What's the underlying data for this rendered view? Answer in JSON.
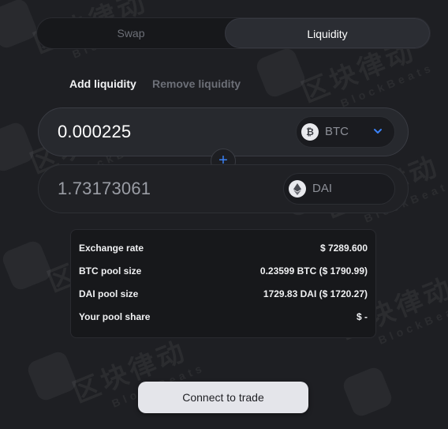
{
  "mode_tabs": {
    "swap": "Swap",
    "liquidity": "Liquidity",
    "active": "Liquidity"
  },
  "sub_tabs": {
    "add": "Add liquidity",
    "remove": "Remove liquidity",
    "active": "Add liquidity"
  },
  "input_1": {
    "amount": "0.000225",
    "token": "BTC",
    "token_icon": "bitcoin-icon",
    "has_dropdown": true
  },
  "input_2": {
    "amount": "1.73173061",
    "token": "DAI",
    "token_icon": "ethereum-icon"
  },
  "plus_symbol": "+",
  "info": [
    {
      "label": "Exchange rate",
      "value": "$ 7289.600"
    },
    {
      "label": "BTC pool size",
      "value": "0.23599 BTC ($ 1790.99)"
    },
    {
      "label": "DAI pool size",
      "value": "1729.83 DAI ($ 1720.27)"
    },
    {
      "label": "Your pool share",
      "value": "$ -"
    }
  ],
  "connect_button": "Connect to trade",
  "watermark": {
    "cn": "区块律动",
    "en": "BlockBeats"
  },
  "colors": {
    "accent": "#3b82f6",
    "background": "#1e1f23",
    "button": "#e4e5ea"
  }
}
